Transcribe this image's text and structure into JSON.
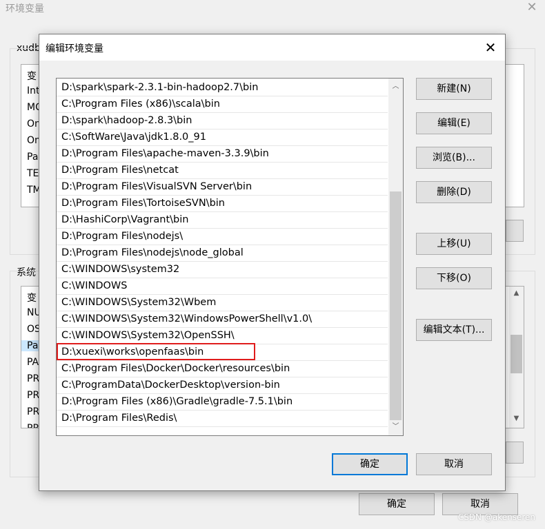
{
  "background_window": {
    "title": "环境变量",
    "user_section_label": "xudb",
    "user_list_rows": [
      "变",
      "Int",
      "MC",
      "On",
      "On",
      "Pa",
      "TE",
      "TM"
    ],
    "system_section_label": "系统",
    "system_list_rows": [
      "变",
      "NU",
      "OS",
      "Pa",
      "PA",
      "PR",
      "PR",
      "PR",
      "PR"
    ],
    "ok_label": "确定",
    "cancel_label": "取消"
  },
  "dialog": {
    "title": "编辑环境变量",
    "paths": [
      "D:\\spark\\spark-2.3.1-bin-hadoop2.7\\bin",
      "C:\\Program Files (x86)\\scala\\bin",
      "D:\\spark\\hadoop-2.8.3\\bin",
      "C:\\SoftWare\\Java\\jdk1.8.0_91",
      "D:\\Program Files\\apache-maven-3.3.9\\bin",
      "D:\\Program Files\\netcat",
      "D:\\Program Files\\VisualSVN Server\\bin",
      "D:\\Program Files\\TortoiseSVN\\bin",
      "D:\\HashiCorp\\Vagrant\\bin",
      "D:\\Program Files\\nodejs\\",
      "D:\\Program Files\\nodejs\\node_global",
      "C:\\WINDOWS\\system32",
      "C:\\WINDOWS",
      "C:\\WINDOWS\\System32\\Wbem",
      "C:\\WINDOWS\\System32\\WindowsPowerShell\\v1.0\\",
      "C:\\WINDOWS\\System32\\OpenSSH\\",
      "D:\\xuexi\\works\\openfaas\\bin",
      "C:\\Program Files\\Docker\\Docker\\resources\\bin",
      "C:\\ProgramData\\DockerDesktop\\version-bin",
      "D:\\Program Files (x86)\\Gradle\\gradle-7.5.1\\bin",
      "D:\\Program Files\\Redis\\"
    ],
    "highlighted_index": 16,
    "buttons": {
      "new": "新建(N)",
      "edit": "编辑(E)",
      "browse": "浏览(B)...",
      "delete": "删除(D)",
      "move_up": "上移(U)",
      "move_down": "下移(O)",
      "edit_text": "编辑文本(T)...",
      "ok": "确定",
      "cancel": "取消"
    }
  },
  "watermark": "CSDN @akenseren",
  "colors": {
    "highlight_border": "#e01b1b",
    "primary_button_border": "#0078d7"
  },
  "icons": {
    "close": "close-icon",
    "scroll_up": "scroll-up-arrow-icon",
    "scroll_down": "scroll-down-arrow-icon"
  }
}
